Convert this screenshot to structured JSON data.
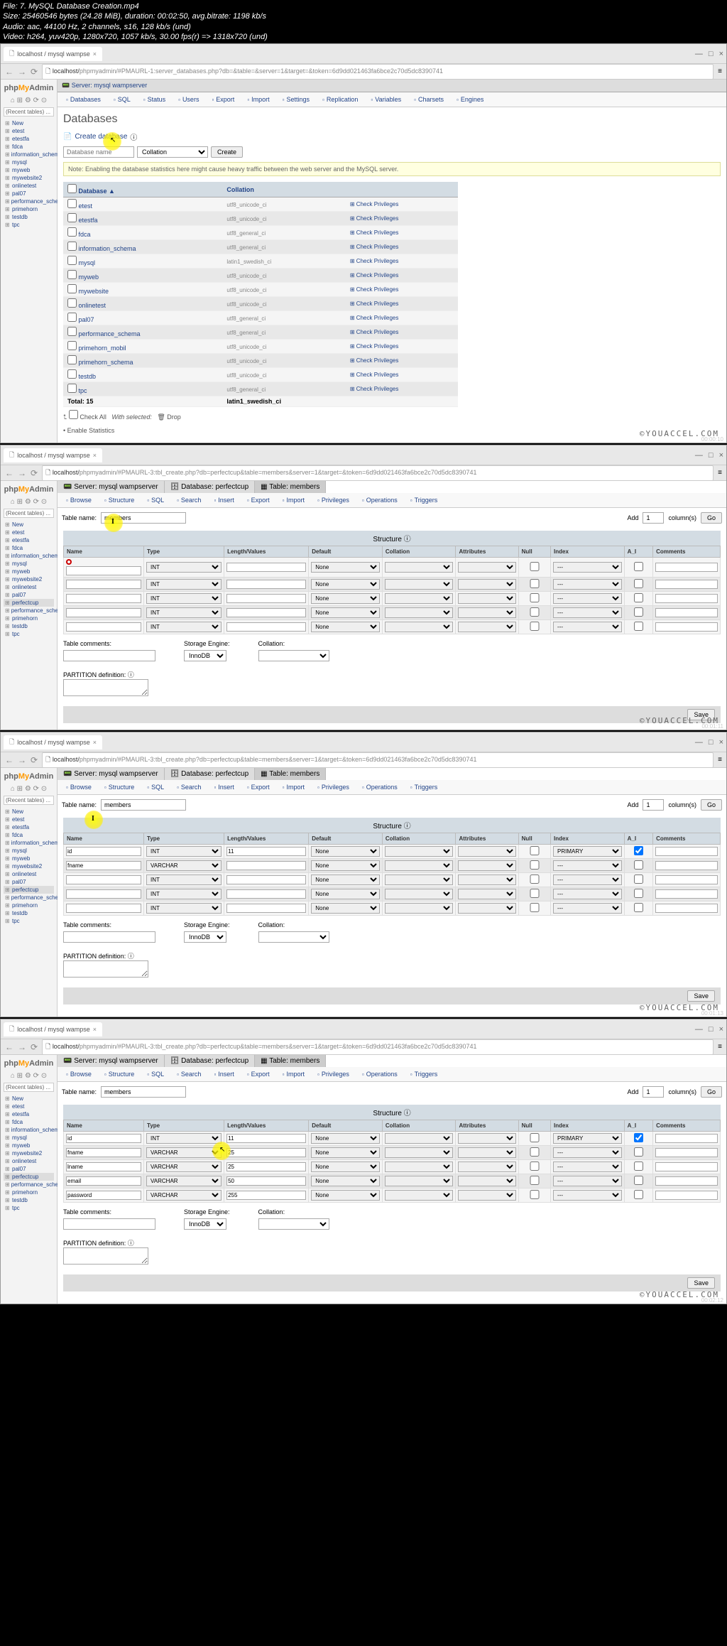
{
  "fileinfo": {
    "line1": "File: 7. MySQL Database Creation.mp4",
    "line2": "Size: 25460546 bytes (24.28 MiB), duration: 00:02:50, avg.bitrate: 1198 kb/s",
    "line3": "Audio: aac, 44100 Hz, 2 channels, s16, 128 kb/s (und)",
    "line4": "Video: h264, yuv420p, 1280x720, 1057 kb/s, 30.00 fps(r) => 1318x720 (und)"
  },
  "browser": {
    "tab_title": "localhost / mysql wampse",
    "url_host": "localhost/",
    "url1": "phpmyadmin/#PMAURL-1:server_databases.php?db=&table=&server=1&target=&token=6d9dd021463fa6bce2c70d5dc8390741",
    "url2": "phpmyadmin/#PMAURL-3:tbl_create.php?db=perfectcup&table=members&server=1&target=&token=6d9dd021463fa6bce2c70d5dc8390741"
  },
  "logo": {
    "php": "php",
    "my": "My",
    "admin": "Admin"
  },
  "recent_label": "(Recent tables) ...",
  "db_list": [
    "New",
    "etest",
    "etestfa",
    "fdca",
    "information_schema",
    "mysql",
    "myweb",
    "mywebsite2",
    "onlinetest",
    "pal07",
    "performance_schema",
    "primehorn",
    "testdb",
    "tpc"
  ],
  "db_list2": [
    "New",
    "etest",
    "etestfa",
    "fdca",
    "information_schema",
    "mysql",
    "myweb",
    "mywebsite2",
    "onlinetest",
    "pal07",
    "perfectcup",
    "performance_schema",
    "primehorn",
    "testdb",
    "tpc"
  ],
  "panel1": {
    "breadcrumb": "Server: mysql wampserver",
    "tabs": [
      "Databases",
      "SQL",
      "Status",
      "Users",
      "Export",
      "Import",
      "Settings",
      "Replication",
      "Variables",
      "Charsets",
      "Engines"
    ],
    "title": "Databases",
    "create_label": "Create database",
    "db_name_placeholder": "Database name",
    "collation_placeholder": "Collation",
    "create_btn": "Create",
    "note": "Note: Enabling the database statistics here might cause heavy traffic between the web server and the MySQL server.",
    "table_headers": [
      "Database",
      "Collation"
    ],
    "rows": [
      {
        "db": "etest",
        "coll": "utf8_unicode_ci",
        "perm": "Check Privileges"
      },
      {
        "db": "etestfa",
        "coll": "utf8_unicode_ci",
        "perm": "Check Privileges"
      },
      {
        "db": "fdca",
        "coll": "utf8_general_ci",
        "perm": "Check Privileges"
      },
      {
        "db": "information_schema",
        "coll": "utf8_general_ci",
        "perm": "Check Privileges"
      },
      {
        "db": "mysql",
        "coll": "latin1_swedish_ci",
        "perm": "Check Privileges"
      },
      {
        "db": "myweb",
        "coll": "utf8_unicode_ci",
        "perm": "Check Privileges"
      },
      {
        "db": "mywebsite",
        "coll": "utf8_unicode_ci",
        "perm": "Check Privileges"
      },
      {
        "db": "onlinetest",
        "coll": "utf8_unicode_ci",
        "perm": "Check Privileges"
      },
      {
        "db": "pal07",
        "coll": "utf8_general_ci",
        "perm": "Check Privileges"
      },
      {
        "db": "performance_schema",
        "coll": "utf8_general_ci",
        "perm": "Check Privileges"
      },
      {
        "db": "primehorn_mobil",
        "coll": "utf8_unicode_ci",
        "perm": "Check Privileges"
      },
      {
        "db": "primehorn_schema",
        "coll": "utf8_unicode_ci",
        "perm": "Check Privileges"
      },
      {
        "db": "testdb",
        "coll": "utf8_unicode_ci",
        "perm": "Check Privileges"
      },
      {
        "db": "tpc",
        "coll": "utf8_general_ci",
        "perm": "Check Privileges"
      }
    ],
    "total_label": "Total: 15",
    "total_coll": "latin1_swedish_ci",
    "check_all": "Check All",
    "with_selected": "With selected:",
    "drop": "Drop",
    "enable_stats": "Enable Statistics"
  },
  "panel2": {
    "breadcrumb1": "Server: mysql wampserver",
    "breadcrumb2": "Database: perfectcup",
    "breadcrumb3": "Table: members",
    "tabs": [
      "Browse",
      "Structure",
      "SQL",
      "Search",
      "Insert",
      "Export",
      "Import",
      "Privileges",
      "Operations",
      "Triggers"
    ],
    "table_name_label": "Table name:",
    "table_name_value": "members",
    "add_label": "Add",
    "add_count": "1",
    "columns_label": "column(s)",
    "go_btn": "Go",
    "structure_title": "Structure",
    "col_headers": [
      "Name",
      "Type",
      "Length/Values",
      "Default",
      "Collation",
      "Attributes",
      "Null",
      "Index",
      "A_I",
      "Comments"
    ],
    "default_type": "INT",
    "default_default": "None",
    "dash": "---",
    "table_comments": "Table comments:",
    "storage_engine": "Storage Engine:",
    "storage_value": "InnoDB",
    "collation_label": "Collation:",
    "partition_label": "PARTITION definition:",
    "save_btn": "Save"
  },
  "panel3": {
    "rows": [
      {
        "name": "id",
        "type": "INT",
        "len": "11",
        "def": "None",
        "idx": "PRIMARY"
      },
      {
        "name": "fname",
        "type": "VARCHAR",
        "len": "",
        "def": "None",
        "idx": "---"
      },
      {
        "name": "",
        "type": "INT",
        "len": "",
        "def": "None",
        "idx": "---"
      },
      {
        "name": "",
        "type": "INT",
        "len": "",
        "def": "None",
        "idx": "---"
      },
      {
        "name": "",
        "type": "INT",
        "len": "",
        "def": "None",
        "idx": "---"
      }
    ]
  },
  "panel4": {
    "rows": [
      {
        "name": "id",
        "type": "INT",
        "len": "11",
        "def": "None",
        "idx": "PRIMARY"
      },
      {
        "name": "fname",
        "type": "VARCHAR",
        "len": "25",
        "def": "None",
        "idx": "---"
      },
      {
        "name": "lname",
        "type": "VARCHAR",
        "len": "25",
        "def": "None",
        "idx": "---"
      },
      {
        "name": "email",
        "type": "VARCHAR",
        "len": "50",
        "def": "None",
        "idx": "---"
      },
      {
        "name": "password",
        "type": "VARCHAR",
        "len": "255",
        "def": "None",
        "idx": "---"
      }
    ]
  },
  "watermark": "©YOUACCEL.COM",
  "timestamps": [
    "00:00:10",
    "00:01:11",
    "00:01:13",
    "00:02:12"
  ]
}
